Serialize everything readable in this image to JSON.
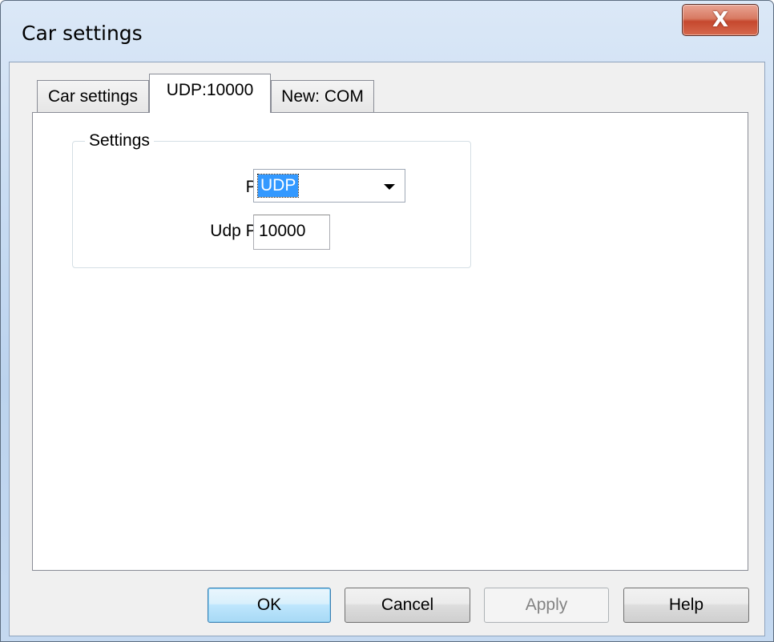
{
  "window": {
    "title": "Car settings",
    "close_label": "X"
  },
  "tabs": [
    {
      "label": "Car settings",
      "active": false
    },
    {
      "label": "UDP:10000",
      "active": true
    },
    {
      "label": "New: COM",
      "active": false
    }
  ],
  "settings_group": {
    "legend": "Settings",
    "port_label": "Port:",
    "port_value": "UDP",
    "udp_port_label": "Udp Port:",
    "udp_port_value": "10000"
  },
  "buttons": {
    "ok": "OK",
    "cancel": "Cancel",
    "apply": "Apply",
    "help": "Help"
  },
  "colors": {
    "selection": "#3399ff",
    "close_button": "#c5482e",
    "default_button_border": "#3c7fb1"
  }
}
